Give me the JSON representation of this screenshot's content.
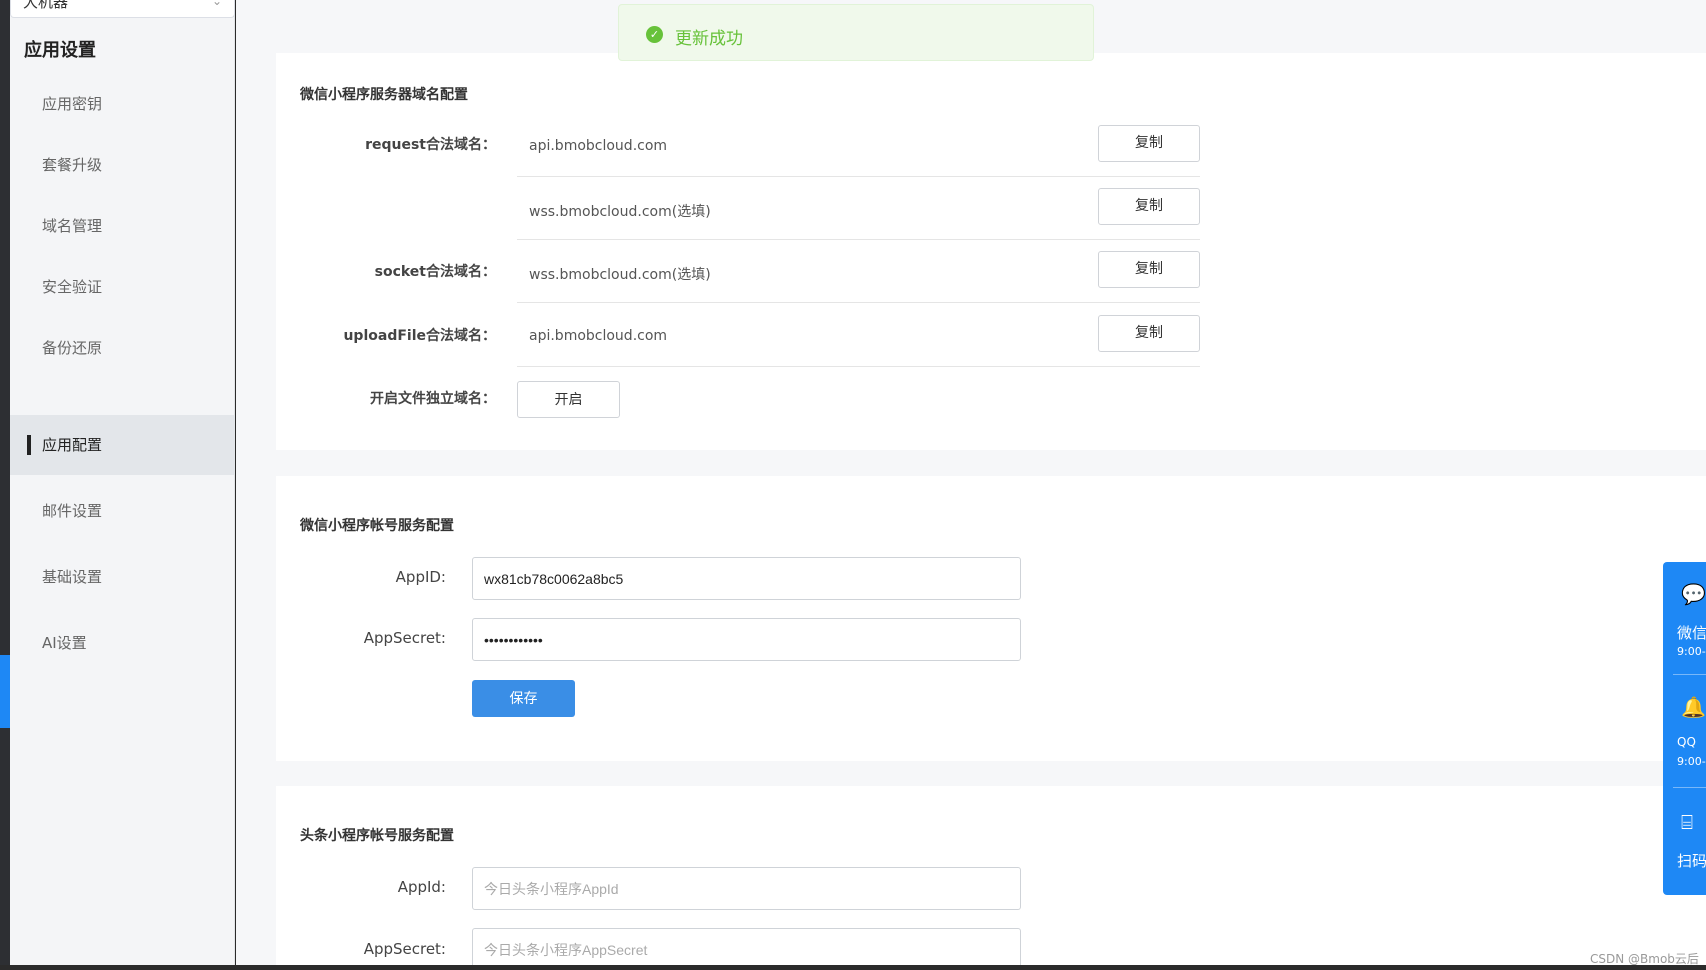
{
  "sidebar": {
    "app_select_value": "大机器",
    "title": "应用设置",
    "items": [
      {
        "label": "应用密钥"
      },
      {
        "label": "套餐升级"
      },
      {
        "label": "域名管理"
      },
      {
        "label": "安全验证"
      },
      {
        "label": "备份还原"
      },
      {
        "label": "应用配置",
        "active": true
      },
      {
        "label": "邮件设置"
      },
      {
        "label": "基础设置"
      },
      {
        "label": "AI设置"
      }
    ]
  },
  "toast": {
    "message": "更新成功",
    "icon": "check-circle-icon"
  },
  "wechat_domain": {
    "title": "微信小程序服务器域名配置",
    "rows": [
      {
        "label": "request合法域名：",
        "value": "api.bmobcloud.com",
        "button": "复制"
      },
      {
        "label": "",
        "value": "wss.bmobcloud.com(选填)",
        "button": "复制"
      },
      {
        "label": "socket合法域名：",
        "value": "wss.bmobcloud.com(选填)",
        "button": "复制"
      },
      {
        "label": "uploadFile合法域名：",
        "value": "api.bmobcloud.com",
        "button": "复制"
      }
    ],
    "independent_label": "开启文件独立域名：",
    "independent_button": "开启"
  },
  "wechat_account": {
    "title": "微信小程序帐号服务配置",
    "appid_label": "AppID:",
    "appid_value": "wx81cb78c0062a8bc5",
    "secret_label": "AppSecret:",
    "secret_value": "••••••••••••",
    "save_button": "保存"
  },
  "toutiao_account": {
    "title": "头条小程序帐号服务配置",
    "appid_label": "AppId:",
    "appid_placeholder": "今日头条小程序AppId",
    "secret_label": "AppSecret:",
    "secret_placeholder": "今日头条小程序AppSecret"
  },
  "float_contact": {
    "items": [
      {
        "icon": "wechat-icon",
        "label": "微信",
        "sub": "9:00-"
      },
      {
        "icon": "qq-icon",
        "label": "QQ",
        "sub": "9:00-"
      },
      {
        "icon": "scan-icon",
        "label": "扫码",
        "sub": ""
      }
    ]
  },
  "watermark": "CSDN @Bmob云后端"
}
